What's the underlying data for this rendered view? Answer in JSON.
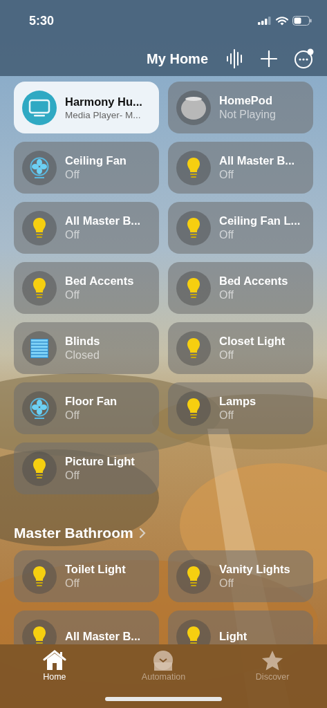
{
  "status_bar": {
    "time": "5:30"
  },
  "header": {
    "title": "My Home"
  },
  "favorites": [
    {
      "name": "Harmony Hu...",
      "status": "Media Player- M...",
      "kind": "tv",
      "on": true
    },
    {
      "name": "HomePod",
      "status": "Not Playing",
      "kind": "speaker",
      "on": false
    },
    {
      "name": "Ceiling Fan",
      "status": "Off",
      "kind": "fan",
      "on": false
    },
    {
      "name": "All Master B...",
      "status": "Off",
      "kind": "light",
      "on": false
    },
    {
      "name": "All Master B...",
      "status": "Off",
      "kind": "light",
      "on": false
    },
    {
      "name": "Ceiling Fan L...",
      "status": "Off",
      "kind": "light",
      "on": false
    },
    {
      "name": "Bed Accents",
      "status": "Off",
      "kind": "light",
      "on": false
    },
    {
      "name": "Bed Accents",
      "status": "Off",
      "kind": "light",
      "on": false
    },
    {
      "name": "Blinds",
      "status": "Closed",
      "kind": "blinds",
      "on": false
    },
    {
      "name": "Closet Light",
      "status": "Off",
      "kind": "light",
      "on": false
    },
    {
      "name": "Floor Fan",
      "status": "Off",
      "kind": "fan",
      "on": false
    },
    {
      "name": "Lamps",
      "status": "Off",
      "kind": "light",
      "on": false
    },
    {
      "name": "Picture Light",
      "status": "Off",
      "kind": "light",
      "on": false
    }
  ],
  "rooms": [
    {
      "title": "Master Bathroom",
      "accessories": [
        {
          "name": "Toilet Light",
          "status": "Off",
          "kind": "light",
          "on": false
        },
        {
          "name": "Vanity Lights",
          "status": "Off",
          "kind": "light",
          "on": false
        },
        {
          "name": "All Master B...",
          "kind": "light",
          "on": false
        },
        {
          "name": "Light",
          "kind": "light",
          "on": false
        }
      ]
    }
  ],
  "tab_bar": [
    {
      "label": "Home",
      "selected": true
    },
    {
      "label": "Automation",
      "selected": false
    },
    {
      "label": "Discover",
      "selected": false
    }
  ]
}
